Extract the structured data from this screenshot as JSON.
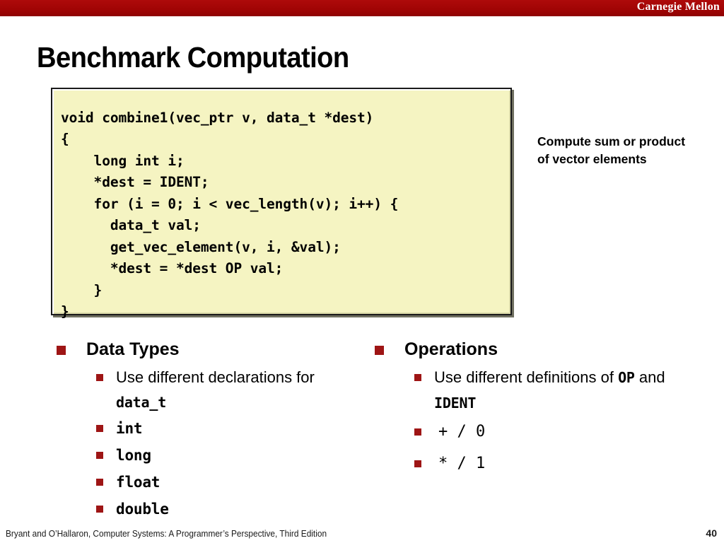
{
  "banner": {
    "institution": "Carnegie Mellon",
    "color": "#a30707"
  },
  "slide": {
    "title": "Benchmark Computation"
  },
  "code_block": {
    "background": "#f5f4c2",
    "border_color": "#1a1a1a",
    "text": "void combine1(vec_ptr v, data_t *dest)\n{\n    long int i;\n    *dest = IDENT;\n    for (i = 0; i < vec_length(v); i++) {\n      data_t val;\n      get_vec_element(v, i, &val);\n      *dest = *dest OP val;\n    }\n}"
  },
  "side_note": {
    "text": "Compute sum or product of vector elements"
  },
  "columns": {
    "left": {
      "heading": "Data Types",
      "items": [
        {
          "prefix": "Use different declarations for ",
          "code": "data_t"
        },
        {
          "code": "int"
        },
        {
          "code": "long"
        },
        {
          "code": "float"
        },
        {
          "code": "double"
        }
      ]
    },
    "right": {
      "heading": "Operations",
      "items": [
        {
          "prefix": "Use different definitions of ",
          "code": "OP",
          "middle": " and ",
          "code2": "IDENT"
        },
        {
          "code": "+ / 0"
        },
        {
          "code": "* / 1"
        }
      ]
    }
  },
  "bullet_color": "#9e1515",
  "footer": {
    "citation": "Bryant and O’Hallaron, Computer Systems: A Programmer’s Perspective, Third Edition",
    "page_number": "40"
  }
}
